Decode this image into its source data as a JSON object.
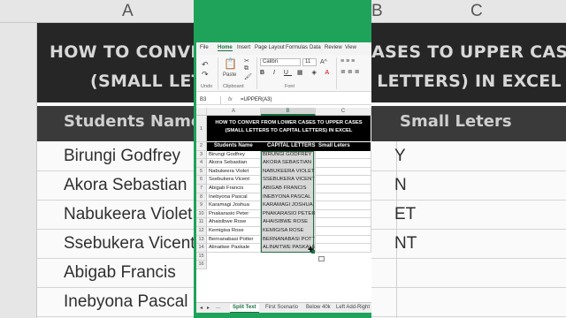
{
  "background": {
    "column_headers": [
      "A",
      "B",
      "C"
    ],
    "title_lines": [
      "HOW TO CONVER FROM LOWER CASES TO UPPER CASES",
      "(SMALL LETTERS TO CAPITAL LETTERS) IN EXCEL"
    ],
    "header_left": "Students Name",
    "header_right": "Small Leters",
    "rows": [
      "Birungi Godfrey",
      "Akora Sebastian",
      "Nabukeera Violet",
      "Ssebukera Vicent",
      "Abigab Francis",
      "Inebyona Pascal"
    ],
    "row_right_fragments": [
      "Y",
      "N",
      "ET",
      "NT",
      "",
      ""
    ]
  },
  "ribbon": {
    "menu": [
      "File",
      "Home",
      "Insert",
      "Page Layout",
      "Formulas",
      "Data",
      "Review",
      "View"
    ],
    "active_menu": "Home",
    "undo_label": "Undo",
    "paste_label": "Paste",
    "clipboard_label": "Clipboard",
    "font_label": "Font",
    "font_name": "Calibri",
    "font_size": "11"
  },
  "formula_bar": {
    "name_box": "B3",
    "fx": "fx",
    "formula": "=UPPER(A3)"
  },
  "sheet": {
    "column_headers": [
      "A",
      "B",
      "C"
    ],
    "row_numbers": [
      "1",
      "2",
      "3",
      "4",
      "5",
      "6",
      "7",
      "8",
      "9",
      "10",
      "11",
      "12",
      "13",
      "14",
      "15",
      "16"
    ],
    "title_line1": "HOW TO CONVER FROM LOWER CASES TO UPPER CASES",
    "title_line2": "(SMALL LETTERS TO CAPITAL LETTERS) IN EXCEL",
    "header": {
      "a": "Students Name",
      "b": "CAPITAL LETTERS",
      "c": "Small Leters"
    },
    "rows": [
      {
        "a": "Birungi Godfrey",
        "b": "BIRUNGI GODFREY"
      },
      {
        "a": "Akora Sebastian",
        "b": "AKORA SEBASTIAN"
      },
      {
        "a": "Nabukeera Violet",
        "b": "NABUKEERA VIOLET"
      },
      {
        "a": "Ssebukera Vicent",
        "b": "SSEBUKERA VICENT"
      },
      {
        "a": "Abigab Francis",
        "b": "ABIGAB FRANCIS"
      },
      {
        "a": "Inebyona Pascal",
        "b": "INEBYONA PASCAL"
      },
      {
        "a": "Karamagi Joshua",
        "b": "KARAMAGI JOSHUA"
      },
      {
        "a": "Pnakarasio Peter",
        "b": "PNAKARASIO PETER"
      },
      {
        "a": "Ahaisibwe Rose",
        "b": "AHAISIBWE ROSE"
      },
      {
        "a": "Kemigisa Rose",
        "b": "KEMIGISA ROSE"
      },
      {
        "a": "Bernanabasi Potter",
        "b": "BERNANABASI POTTER"
      },
      {
        "a": "Alinaitwe Paskale",
        "b": "ALINAITWE PASKALE"
      }
    ]
  },
  "tabs": {
    "items": [
      "Split Text",
      "First Scenario",
      "Below 40k",
      "Left Add-Right"
    ],
    "active": "Split Text",
    "more": "..."
  }
}
